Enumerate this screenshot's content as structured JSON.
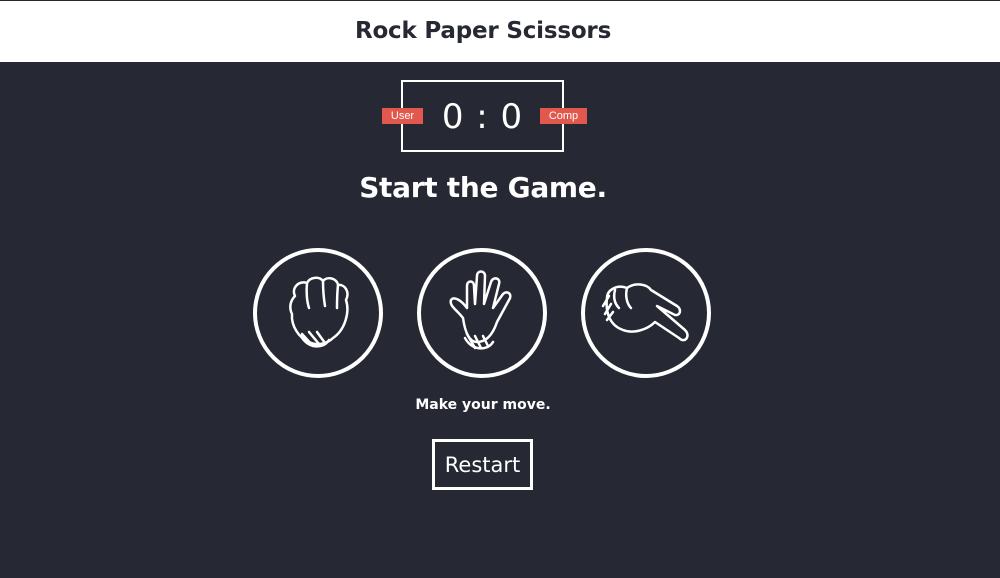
{
  "header": {
    "title": "Rock Paper Scissors"
  },
  "scoreboard": {
    "user_label": "User",
    "comp_label": "Comp",
    "user_score": 0,
    "comp_score": 0,
    "score_display": "0 : 0"
  },
  "result": {
    "title": "Start the Game."
  },
  "choices": [
    {
      "name": "rock",
      "icon": "rock-fist-icon"
    },
    {
      "name": "paper",
      "icon": "paper-hand-icon"
    },
    {
      "name": "scissors",
      "icon": "scissors-hand-icon"
    }
  ],
  "action_message": "Make your move.",
  "restart_label": "Restart",
  "colors": {
    "background": "#262833",
    "header_bg": "#ffffff",
    "badge": "#e2584d",
    "foreground": "#ffffff"
  }
}
